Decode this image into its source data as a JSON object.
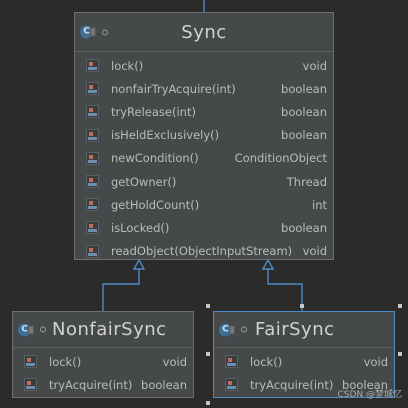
{
  "sync": {
    "name": "Sync",
    "methods": [
      {
        "name": "lock()",
        "type": "void"
      },
      {
        "name": "nonfairTryAcquire(int)",
        "type": "boolean"
      },
      {
        "name": "tryRelease(int)",
        "type": "boolean"
      },
      {
        "name": "isHeldExclusively()",
        "type": "boolean"
      },
      {
        "name": "newCondition()",
        "type": "ConditionObject"
      },
      {
        "name": "getOwner()",
        "type": "Thread"
      },
      {
        "name": "getHoldCount()",
        "type": "int"
      },
      {
        "name": "isLocked()",
        "type": "boolean"
      },
      {
        "name": "readObject(ObjectInputStream)",
        "type": "void"
      }
    ]
  },
  "nonfair": {
    "name": "NonfairSync",
    "methods": [
      {
        "name": "lock()",
        "type": "void"
      },
      {
        "name": "tryAcquire(int)",
        "type": "boolean"
      }
    ]
  },
  "fair": {
    "name": "FairSync",
    "methods": [
      {
        "name": "lock()",
        "type": "void"
      },
      {
        "name": "tryAcquire(int)",
        "type": "boolean"
      }
    ]
  },
  "icons": {
    "class_icon": "class-icon",
    "method_icon": "method-icon"
  },
  "colors": {
    "background": "#2b2b2b",
    "box": "#45494a",
    "edge": "#4d8ac6"
  },
  "watermark": "CSDN @梦城忆"
}
